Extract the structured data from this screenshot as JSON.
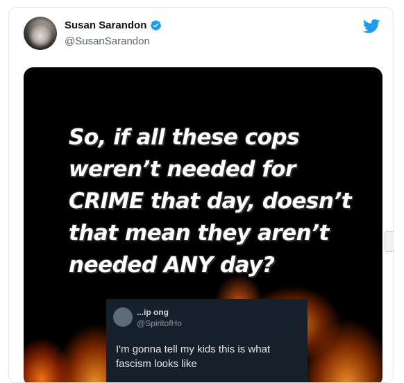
{
  "tweet": {
    "display_name": "Susan Sarandon",
    "handle": "@SusanSarandon",
    "verified_icon": "verified-badge-icon",
    "brand_icon": "twitter-bird-icon",
    "brand_color": "#1d9bf0"
  },
  "media": {
    "headline": "So, if all these cops weren’t needed for CRIME that day, doesn’t that mean they aren’t needed ANY day?",
    "embedded_tweet": {
      "name": "...ip ong",
      "handle": "@SpiritofHo",
      "text": "I'm gonna tell my kids this is what fascism looks like"
    }
  }
}
